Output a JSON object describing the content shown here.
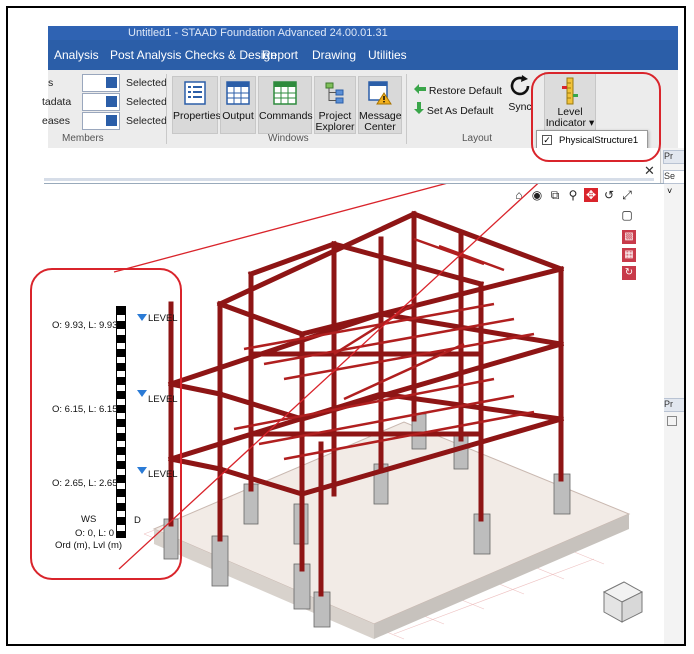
{
  "window": {
    "title": "Untitled1 - STAAD Foundation Advanced 24.00.01.31"
  },
  "menu": {
    "items": [
      "Analysis",
      "Post Analysis Checks & Design",
      "Report",
      "Drawing",
      "Utilities"
    ]
  },
  "members_group": {
    "label": "Members",
    "rows": [
      {
        "label": "s",
        "status": "Selected"
      },
      {
        "label": "tadata",
        "status": "Selected"
      },
      {
        "label": "eases",
        "status": "Selected"
      }
    ]
  },
  "windows_group": {
    "label": "Windows",
    "buttons": [
      {
        "label": "Properties"
      },
      {
        "label": "Output"
      },
      {
        "label": "Commands"
      },
      {
        "label_line1": "Project",
        "label_line2": "Explorer"
      },
      {
        "label_line1": "Message",
        "label_line2": "Center"
      }
    ]
  },
  "layout_group": {
    "label": "Layout",
    "restore_default": "Restore Default",
    "set_as_default": "Set As Default",
    "sync": "Sync"
  },
  "level_indicator": {
    "label_line1": "Level",
    "label_line2": "Indicator ▾",
    "dropdown_item": "PhysicalStructure1",
    "checked": true
  },
  "right_panel": {
    "tabs": [
      "Pr",
      "Se",
      "Pr"
    ]
  },
  "levels": [
    {
      "ord": "O: 9.93, L: 9.93",
      "name": "LEVEL"
    },
    {
      "ord": "O: 6.15, L: 6.15",
      "name": "LEVEL"
    },
    {
      "ord": "O: 2.65, L: 2.65",
      "name": "LEVEL"
    },
    {
      "ord": "O: 0, L: 0",
      "name": "D"
    }
  ],
  "level_axis_caption": "Ord (m), Lvl (m)",
  "level_base_marker": "WS",
  "colors": {
    "accent": "#2b5ea8",
    "steel": "#9e1b1b",
    "highlight": "#d9242b"
  }
}
